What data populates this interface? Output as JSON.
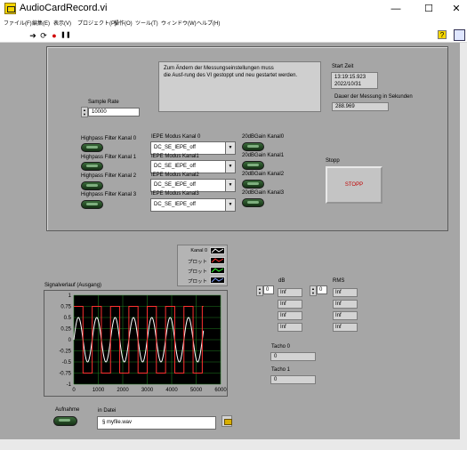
{
  "window": {
    "title": "AudioCardRecord.vi",
    "min_glyph": "—",
    "max_glyph": "☐",
    "close_glyph": "✕"
  },
  "menu": [
    "ファイル(F)",
    "編集(E)",
    "表示(V)",
    "プロジェクト(P)",
    "操作(O)",
    "ツール(T)",
    "ウィンドウ(W)",
    "ヘルプ(H)"
  ],
  "toolbar": {
    "run": "➔",
    "run_cont": "⟳",
    "abort": "●",
    "pause": "❚❚",
    "help": "?"
  },
  "message": "Zum Ändern der Messungseinstellungen muss\ndie Ausf-rung des VI gestoppt und neu gestartet werden.",
  "start_time": {
    "label": "Start Zeit",
    "time": "13:19:15.923",
    "date": "2022/10/31"
  },
  "duration": {
    "label": "Dauer der Messung in Sekunden",
    "value": "288.969"
  },
  "sample_rate": {
    "label": "Sample Rate",
    "value": "10000"
  },
  "channels": [
    {
      "highpass": "Highpass Filter Kanal 0",
      "iepe_label": "IEPE Modus Kanal 0",
      "iepe_value": "DC_SE_IEPE_off",
      "gain": "20dBGain Kanal0"
    },
    {
      "highpass": "Highpass Filter Kanal 1",
      "iepe_label": "IEPE Modus Kanal1",
      "iepe_value": "DC_SE_IEPE_off",
      "gain": "20dBGain Kanal1"
    },
    {
      "highpass": "Highpass Filter Kanal 2",
      "iepe_label": "IEPE Modus Kanal2",
      "iepe_value": "DC_SE_IEPE_off",
      "gain": "20dBGain Kanal2"
    },
    {
      "highpass": "Highpass Filter Kanal 3",
      "iepe_label": "IEPE Modus Kanal3",
      "iepe_value": "DC_SE_IEPE_off",
      "gain": "20dBGain Kanal3"
    }
  ],
  "stop": {
    "label": "Stopp",
    "button": "STOPP"
  },
  "legend": [
    {
      "name": "Kanal 0",
      "color": "#ffffff"
    },
    {
      "name": "プロット",
      "color": "#ff3030"
    },
    {
      "name": "プロット",
      "color": "#30ff30"
    },
    {
      "name": "プロット",
      "color": "#80a0ff"
    }
  ],
  "graph": {
    "title": "Signalverlauf (Ausgang)",
    "plot_bg": "#000000",
    "grid_color": "#1f7a1f"
  },
  "chart_data": {
    "type": "line",
    "xlim": [
      0,
      6000
    ],
    "ylim": [
      -1,
      1
    ],
    "xticks": [
      "0",
      "1000",
      "2000",
      "3000",
      "4000",
      "5000",
      "6000"
    ],
    "yticks": [
      "1",
      "0.75",
      "0.5",
      "0.25",
      "0",
      "-0.25",
      "-0.5",
      "-0.75",
      "-1"
    ],
    "series": [
      {
        "name": "Kanal 0",
        "color": "#ffffff",
        "shape": "sine",
        "x_start": 0,
        "x_end": 5300,
        "amplitude": 0.5,
        "period": 750
      },
      {
        "color": "#ff3030",
        "shape": "square",
        "x_start": 0,
        "x_end": 5300,
        "amplitude": 0.75,
        "period": 750
      }
    ]
  },
  "db": {
    "label": "dB",
    "index": "0",
    "values": [
      "Inf",
      "Inf",
      "Inf",
      "Inf"
    ]
  },
  "rms": {
    "label": "RMS",
    "index": "0",
    "values": [
      "Inf",
      "Inf",
      "Inf",
      "Inf"
    ]
  },
  "tacho0": {
    "label": "Tacho 0",
    "value": "0"
  },
  "tacho1": {
    "label": "Tacho 1",
    "value": "0"
  },
  "record": {
    "label": "Aufnahme"
  },
  "file": {
    "label": "in Datei",
    "value": "myfile.wav",
    "prefix": "§"
  }
}
